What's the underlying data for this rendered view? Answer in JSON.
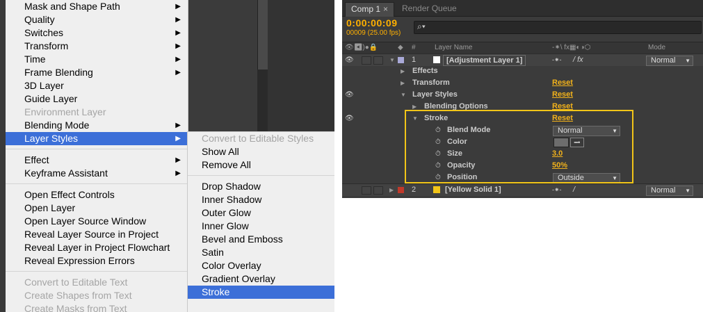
{
  "context_menu": {
    "group1": [
      {
        "label": "Mask and Shape Path",
        "submenu": true,
        "disabled": false
      },
      {
        "label": "Quality",
        "submenu": true,
        "disabled": false
      },
      {
        "label": "Switches",
        "submenu": true,
        "disabled": false
      },
      {
        "label": "Transform",
        "submenu": true,
        "disabled": false
      },
      {
        "label": "Time",
        "submenu": true,
        "disabled": false
      },
      {
        "label": "Frame Blending",
        "submenu": true,
        "disabled": false
      },
      {
        "label": "3D Layer",
        "submenu": false,
        "disabled": false
      },
      {
        "label": "Guide Layer",
        "submenu": false,
        "disabled": false
      },
      {
        "label": "Environment Layer",
        "submenu": false,
        "disabled": true
      },
      {
        "label": "Blending Mode",
        "submenu": true,
        "disabled": false
      },
      {
        "label": "Layer Styles",
        "submenu": true,
        "disabled": false,
        "selected": true
      }
    ],
    "group2": [
      {
        "label": "Effect",
        "submenu": true
      },
      {
        "label": "Keyframe Assistant",
        "submenu": true
      }
    ],
    "group3": [
      {
        "label": "Open Effect Controls"
      },
      {
        "label": "Open Layer"
      },
      {
        "label": "Open Layer Source Window"
      },
      {
        "label": "Reveal Layer Source in Project"
      },
      {
        "label": "Reveal Layer in Project Flowchart"
      },
      {
        "label": "Reveal Expression Errors"
      }
    ],
    "group4": [
      {
        "label": "Convert to Editable Text",
        "disabled": true
      },
      {
        "label": "Create Shapes from Text",
        "disabled": true
      },
      {
        "label": "Create Masks from Text",
        "disabled": true
      }
    ]
  },
  "submenu": {
    "group1": [
      {
        "label": "Convert to Editable Styles",
        "disabled": true
      },
      {
        "label": "Show All",
        "disabled": false
      },
      {
        "label": "Remove All",
        "disabled": false
      }
    ],
    "group2": [
      {
        "label": "Drop Shadow"
      },
      {
        "label": "Inner Shadow"
      },
      {
        "label": "Outer Glow"
      },
      {
        "label": "Inner Glow"
      },
      {
        "label": "Bevel and Emboss"
      },
      {
        "label": "Satin"
      },
      {
        "label": "Color Overlay"
      },
      {
        "label": "Gradient Overlay"
      },
      {
        "label": "Stroke",
        "selected": true
      }
    ]
  },
  "timeline": {
    "tabs": {
      "active": "Comp 1",
      "inactive": "Render Queue",
      "close": "×"
    },
    "timecode": "0:00:00:09",
    "frames": "00009 (25.00 fps)",
    "search_icon": "⌕▾",
    "columns": {
      "num": "#",
      "layer_name": "Layer Name",
      "mode": "Mode",
      "switches": "-⁕\\ fx▦◐◑⬡"
    },
    "layer1": {
      "num": "1",
      "name": "[Adjustment Layer 1]",
      "mode": "Normal",
      "label_color": "#a9a9d8",
      "color": "#ffffff"
    },
    "props": {
      "effects": "Effects",
      "transform": "Transform",
      "transform_reset": "Reset",
      "layer_styles": "Layer Styles",
      "layer_styles_reset": "Reset",
      "blending_options": "Blending Options",
      "blending_reset": "Reset",
      "stroke": "Stroke",
      "stroke_reset": "Reset",
      "blend_mode": "Blend Mode",
      "blend_mode_value": "Normal",
      "color": "Color",
      "size": "Size",
      "size_value": "3.0",
      "opacity": "Opacity",
      "opacity_value": "50%",
      "position": "Position",
      "position_value": "Outside"
    },
    "layer2": {
      "num": "2",
      "name": "[Yellow Solid 1]",
      "mode": "Normal",
      "label_color": "#c0392b",
      "color": "#f2c518"
    },
    "accent": "#f2c518"
  }
}
